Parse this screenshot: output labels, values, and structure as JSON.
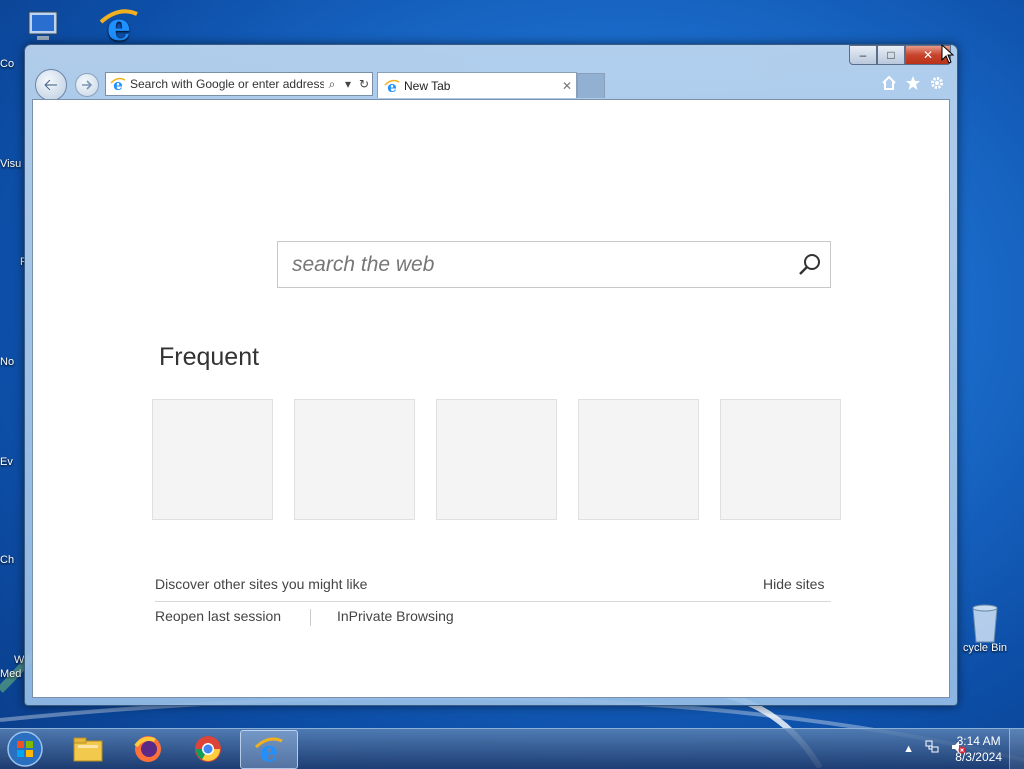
{
  "desktop": {
    "icons_left": [
      "Co",
      "Visu",
      "F",
      "No",
      "Ev",
      "Ch",
      "W",
      "Med"
    ],
    "recycle_bin": "cycle Bin"
  },
  "browser": {
    "address": {
      "placeholder": "Search with Google or enter address",
      "search_icon": "magnifier-icon",
      "dropdown_icon": "chevron-down-icon",
      "refresh_icon": "refresh-icon"
    },
    "tab": {
      "label": "New Tab",
      "close": "✕"
    },
    "tools": [
      "home-icon",
      "star-icon",
      "gear-icon"
    ],
    "caption": {
      "min": "–",
      "max": "□",
      "close": "✕"
    }
  },
  "newtab": {
    "search_placeholder": "search the web",
    "frequent_title": "Frequent",
    "tiles_count": 5,
    "discover": "Discover other sites you might like",
    "hide_sites": "Hide sites",
    "reopen": "Reopen last session",
    "inprivate": "InPrivate Browsing"
  },
  "taskbar": {
    "apps": [
      "file-explorer-icon",
      "firefox-icon",
      "chrome-icon",
      "internet-explorer-icon"
    ],
    "active_app": "internet-explorer-icon",
    "time": "3:14 AM",
    "date": "8/3/2024"
  },
  "colors": {
    "accent": "#1c6fcf",
    "ie_blue": "#1e90ff",
    "ie_gold": "#f0b020",
    "close_red": "#c8442c"
  }
}
